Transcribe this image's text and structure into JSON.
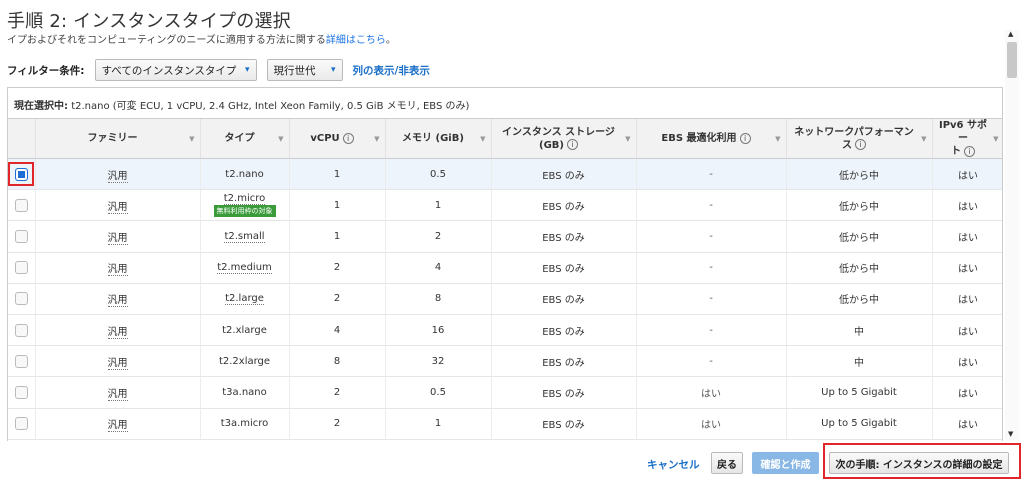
{
  "header": {
    "title": "手順 2: インスタンスタイプの選択",
    "subtitle_text": "イプおよびそれをコンピューティングのニーズに適用する方法に関する",
    "subtitle_link": "詳細はこちら",
    "subtitle_end": "。"
  },
  "filter": {
    "label": "フィルター条件:",
    "dropdown1": "すべてのインスタンスタイプ",
    "dropdown2": "現行世代",
    "columns_link": "列の表示/非表示",
    "chevron": "▾"
  },
  "current_selection": {
    "label": "現在選択中:",
    "text": "t2.nano (可変 ECU, 1 vCPU, 2.4 GHz, Intel Xeon Family, 0.5 GiB メモリ, EBS のみ)"
  },
  "table": {
    "headers": {
      "family": "ファミリー",
      "type": "タイプ",
      "vcpu": "vCPU",
      "memory": "メモリ (GiB)",
      "storage_l1": "インスタンス ストレージ",
      "storage_l2": "(GB)",
      "ebs": "EBS 最適化利用",
      "network_l1": "ネットワークパフォーマン",
      "network_l2": "ス",
      "ipv6_l1": "IPv6 サポー",
      "ipv6_l2": "ト",
      "info_glyph": "i",
      "sort_glyph": "▼"
    },
    "free_tier_badge": "無料利用枠の対象",
    "rows": [
      {
        "family": "汎用",
        "type": "t2.nano",
        "vcpu": "1",
        "memory": "0.5",
        "storage": "EBS のみ",
        "ebs": "-",
        "network": "低から中",
        "ipv6": "はい",
        "selected": true
      },
      {
        "family": "汎用",
        "type": "t2.micro",
        "vcpu": "1",
        "memory": "1",
        "storage": "EBS のみ",
        "ebs": "-",
        "network": "低から中",
        "ipv6": "はい",
        "selected": false
      },
      {
        "family": "汎用",
        "type": "t2.small",
        "vcpu": "1",
        "memory": "2",
        "storage": "EBS のみ",
        "ebs": "-",
        "network": "低から中",
        "ipv6": "はい",
        "selected": false
      },
      {
        "family": "汎用",
        "type": "t2.medium",
        "vcpu": "2",
        "memory": "4",
        "storage": "EBS のみ",
        "ebs": "-",
        "network": "低から中",
        "ipv6": "はい",
        "selected": false
      },
      {
        "family": "汎用",
        "type": "t2.large",
        "vcpu": "2",
        "memory": "8",
        "storage": "EBS のみ",
        "ebs": "-",
        "network": "低から中",
        "ipv6": "はい",
        "selected": false
      },
      {
        "family": "汎用",
        "type": "t2.xlarge",
        "vcpu": "4",
        "memory": "16",
        "storage": "EBS のみ",
        "ebs": "-",
        "network": "中",
        "ipv6": "はい",
        "selected": false
      },
      {
        "family": "汎用",
        "type": "t2.2xlarge",
        "vcpu": "8",
        "memory": "32",
        "storage": "EBS のみ",
        "ebs": "-",
        "network": "中",
        "ipv6": "はい",
        "selected": false
      },
      {
        "family": "汎用",
        "type": "t3a.nano",
        "vcpu": "2",
        "memory": "0.5",
        "storage": "EBS のみ",
        "ebs": "はい",
        "network": "Up to 5 Gigabit",
        "ipv6": "はい",
        "selected": false
      },
      {
        "family": "汎用",
        "type": "t3a.micro",
        "vcpu": "2",
        "memory": "1",
        "storage": "EBS のみ",
        "ebs": "はい",
        "network": "Up to 5 Gigabit",
        "ipv6": "はい",
        "selected": false
      }
    ]
  },
  "footer": {
    "cancel": "キャンセル",
    "back": "戻る",
    "review": "確認と作成",
    "next": "次の手順: インスタンスの詳細の設定"
  },
  "scrollbar": {
    "up": "▲",
    "down": "▼"
  }
}
